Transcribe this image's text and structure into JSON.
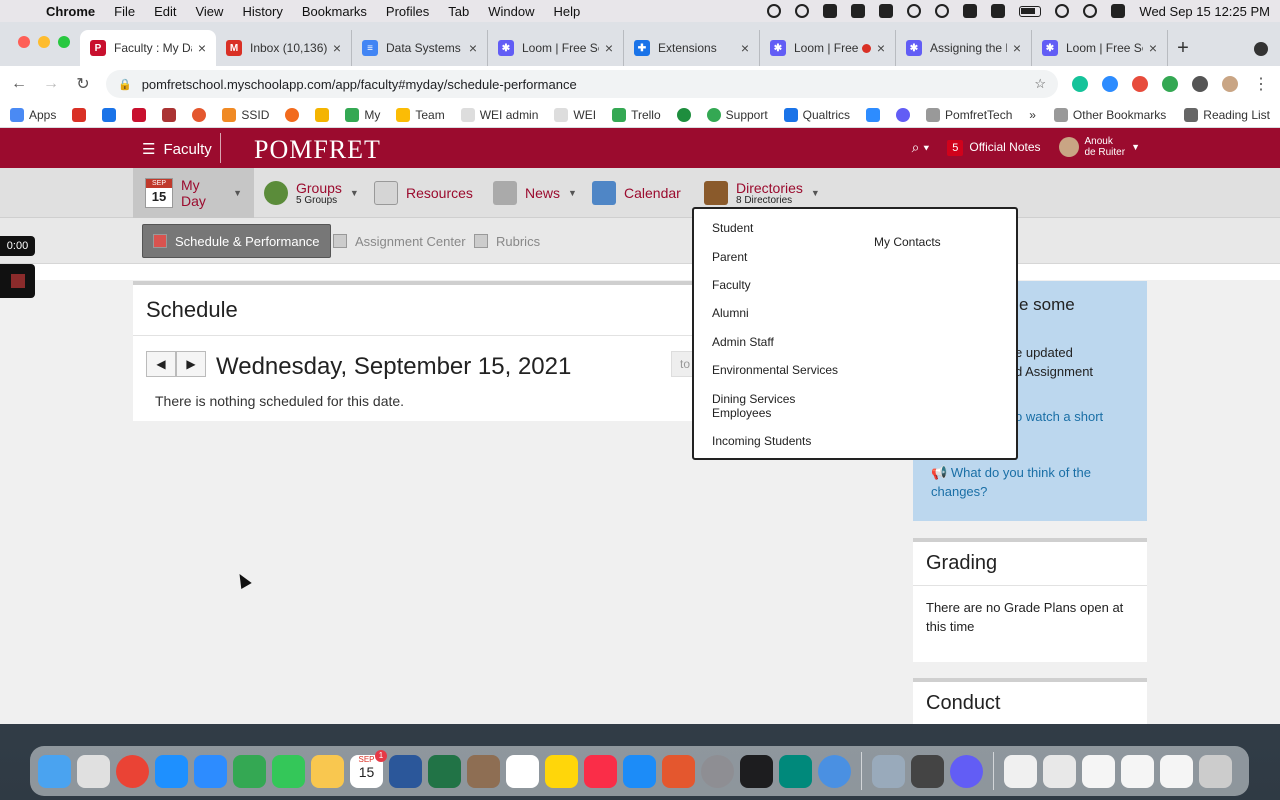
{
  "menubar": {
    "app": "Chrome",
    "items": [
      "File",
      "Edit",
      "View",
      "History",
      "Bookmarks",
      "Profiles",
      "Tab",
      "Window",
      "Help"
    ],
    "clock": "Wed Sep 15  12:25 PM"
  },
  "tabs": [
    {
      "title": "Faculty : My Da",
      "color": "#c8102e",
      "glyph": "P"
    },
    {
      "title": "Inbox (10,136) -",
      "color": "#d93025",
      "glyph": "M"
    },
    {
      "title": "Data Systems M",
      "color": "#4285f4",
      "glyph": "≡"
    },
    {
      "title": "Loom | Free Scr",
      "color": "#625df5",
      "glyph": "✱"
    },
    {
      "title": "Extensions",
      "color": "#1a73e8",
      "glyph": "✚"
    },
    {
      "title": "Loom | Free",
      "color": "#625df5",
      "glyph": "✱"
    },
    {
      "title": "Assigning the F",
      "color": "#625df5",
      "glyph": "✱"
    },
    {
      "title": "Loom | Free Scr",
      "color": "#625df5",
      "glyph": "✱"
    }
  ],
  "address": "pomfretschool.myschoolapp.com/app/faculty#myday/schedule-performance",
  "bookmarks": {
    "items": [
      "Apps",
      "",
      "",
      "",
      "",
      "",
      "SSID",
      "",
      "",
      "My",
      "Team",
      "WEI admin",
      "WEI",
      "Trello",
      "",
      "Support",
      "Qualtrics",
      "",
      "",
      "PomfretTech"
    ],
    "other": "Other Bookmarks",
    "reading": "Reading List"
  },
  "site": {
    "menu_label": "Faculty",
    "logo": "POMFRET",
    "notes_count": "5",
    "notes_label": "Official Notes",
    "user_first": "Anouk",
    "user_last": "de Ruiter"
  },
  "nav": {
    "cal_month": "SEP",
    "cal_day": "15",
    "my_day": "My Day",
    "groups": "Groups",
    "groups_sub": "5 Groups",
    "resources": "Resources",
    "news": "News",
    "calendar": "Calendar",
    "directories": "Directories",
    "directories_sub": "8 Directories"
  },
  "subnav": {
    "schedule": "Schedule & Performance",
    "assignment": "Assignment Center",
    "rubrics": "Rubrics"
  },
  "directories_menu": {
    "items": [
      "Student",
      "Parent",
      "Faculty",
      "Alumni",
      "Admin Staff",
      "Environmental Services",
      "Dining Services Employees",
      "Incoming Students"
    ],
    "right": "My Contacts"
  },
  "schedule": {
    "title": "Schedule",
    "date": "Wednesday, September 15, 2021",
    "empty": "There is nothing scheduled for this date.",
    "today_partial": "to",
    "prev": "◀",
    "next": "▶"
  },
  "announcement": {
    "title_partial": "e some",
    "line1": "e updated",
    "line2": "d Assignment",
    "link_partial": "o watch a short",
    "question": "What do you think of the changes?"
  },
  "grading": {
    "title": "Grading",
    "body": "There are no Grade Plans open at this time"
  },
  "conduct": {
    "title": "Conduct"
  },
  "loom": {
    "timer": "0:00"
  },
  "dock": {
    "calendar_month": "SEP",
    "calendar_day": "15",
    "calendar_badge": "1"
  }
}
